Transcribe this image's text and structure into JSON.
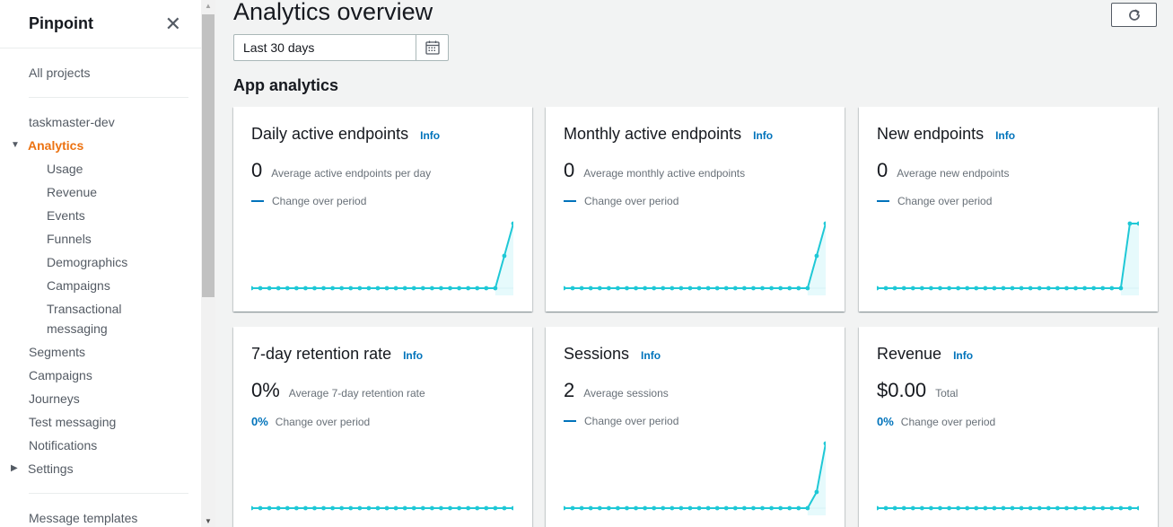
{
  "sidebar": {
    "title": "Pinpoint",
    "close_icon": "close-icon",
    "all_projects": "All projects",
    "project": "taskmaster-dev",
    "analytics": "Analytics",
    "analytics_items": [
      "Usage",
      "Revenue",
      "Events",
      "Funnels",
      "Demographics",
      "Campaigns",
      "Transactional",
      "messaging"
    ],
    "items": [
      "Segments",
      "Campaigns",
      "Journeys",
      "Test messaging",
      "Notifications"
    ],
    "settings": "Settings",
    "message_templates": "Message templates"
  },
  "header": {
    "title": "Analytics overview",
    "refresh_icon": "refresh-icon"
  },
  "date_range": {
    "value": "Last 30 days",
    "calendar_icon": "calendar-icon"
  },
  "section_title": "App analytics",
  "colors": {
    "accent": "#ec7211",
    "link": "#0073bb",
    "spark_line": "#1fc8d6",
    "spark_fill": "#e6fafc"
  },
  "cards": [
    {
      "title": "Daily active endpoints",
      "info": "Info",
      "value": "0",
      "label": "Average active endpoints per day",
      "change_pct": "",
      "change_label": "Change over period",
      "spark": [
        0,
        0,
        0,
        0,
        0,
        0,
        0,
        0,
        0,
        0,
        0,
        0,
        0,
        0,
        0,
        0,
        0,
        0,
        0,
        0,
        0,
        0,
        0,
        0,
        0,
        0,
        0,
        0,
        0.5,
        1
      ]
    },
    {
      "title": "Monthly active endpoints",
      "info": "Info",
      "value": "0",
      "label": "Average monthly active endpoints",
      "change_pct": "",
      "change_label": "Change over period",
      "spark": [
        0,
        0,
        0,
        0,
        0,
        0,
        0,
        0,
        0,
        0,
        0,
        0,
        0,
        0,
        0,
        0,
        0,
        0,
        0,
        0,
        0,
        0,
        0,
        0,
        0,
        0,
        0,
        0,
        0.5,
        1
      ]
    },
    {
      "title": "New endpoints",
      "info": "Info",
      "value": "0",
      "label": "Average new endpoints",
      "change_pct": "",
      "change_label": "Change over period",
      "spark": [
        0,
        0,
        0,
        0,
        0,
        0,
        0,
        0,
        0,
        0,
        0,
        0,
        0,
        0,
        0,
        0,
        0,
        0,
        0,
        0,
        0,
        0,
        0,
        0,
        0,
        0,
        0,
        0,
        1,
        1
      ]
    },
    {
      "title": "7-day retention rate",
      "info": "Info",
      "value": "0%",
      "label": "Average 7-day retention rate",
      "change_pct": "0%",
      "change_label": "Change over period",
      "spark": [
        0,
        0,
        0,
        0,
        0,
        0,
        0,
        0,
        0,
        0,
        0,
        0,
        0,
        0,
        0,
        0,
        0,
        0,
        0,
        0,
        0,
        0,
        0,
        0,
        0,
        0,
        0,
        0,
        0,
        0
      ]
    },
    {
      "title": "Sessions",
      "info": "Info",
      "value": "2",
      "label": "Average sessions",
      "change_pct": "",
      "change_label": "Change over period",
      "spark": [
        0,
        0,
        0,
        0,
        0,
        0,
        0,
        0,
        0,
        0,
        0,
        0,
        0,
        0,
        0,
        0,
        0,
        0,
        0,
        0,
        0,
        0,
        0,
        0,
        0,
        0,
        0,
        0,
        0.25,
        1
      ]
    },
    {
      "title": "Revenue",
      "info": "Info",
      "value": "$0.00",
      "label": "Total",
      "change_pct": "0%",
      "change_label": "Change over period",
      "spark": [
        0,
        0,
        0,
        0,
        0,
        0,
        0,
        0,
        0,
        0,
        0,
        0,
        0,
        0,
        0,
        0,
        0,
        0,
        0,
        0,
        0,
        0,
        0,
        0,
        0,
        0,
        0,
        0,
        0,
        0
      ]
    }
  ]
}
